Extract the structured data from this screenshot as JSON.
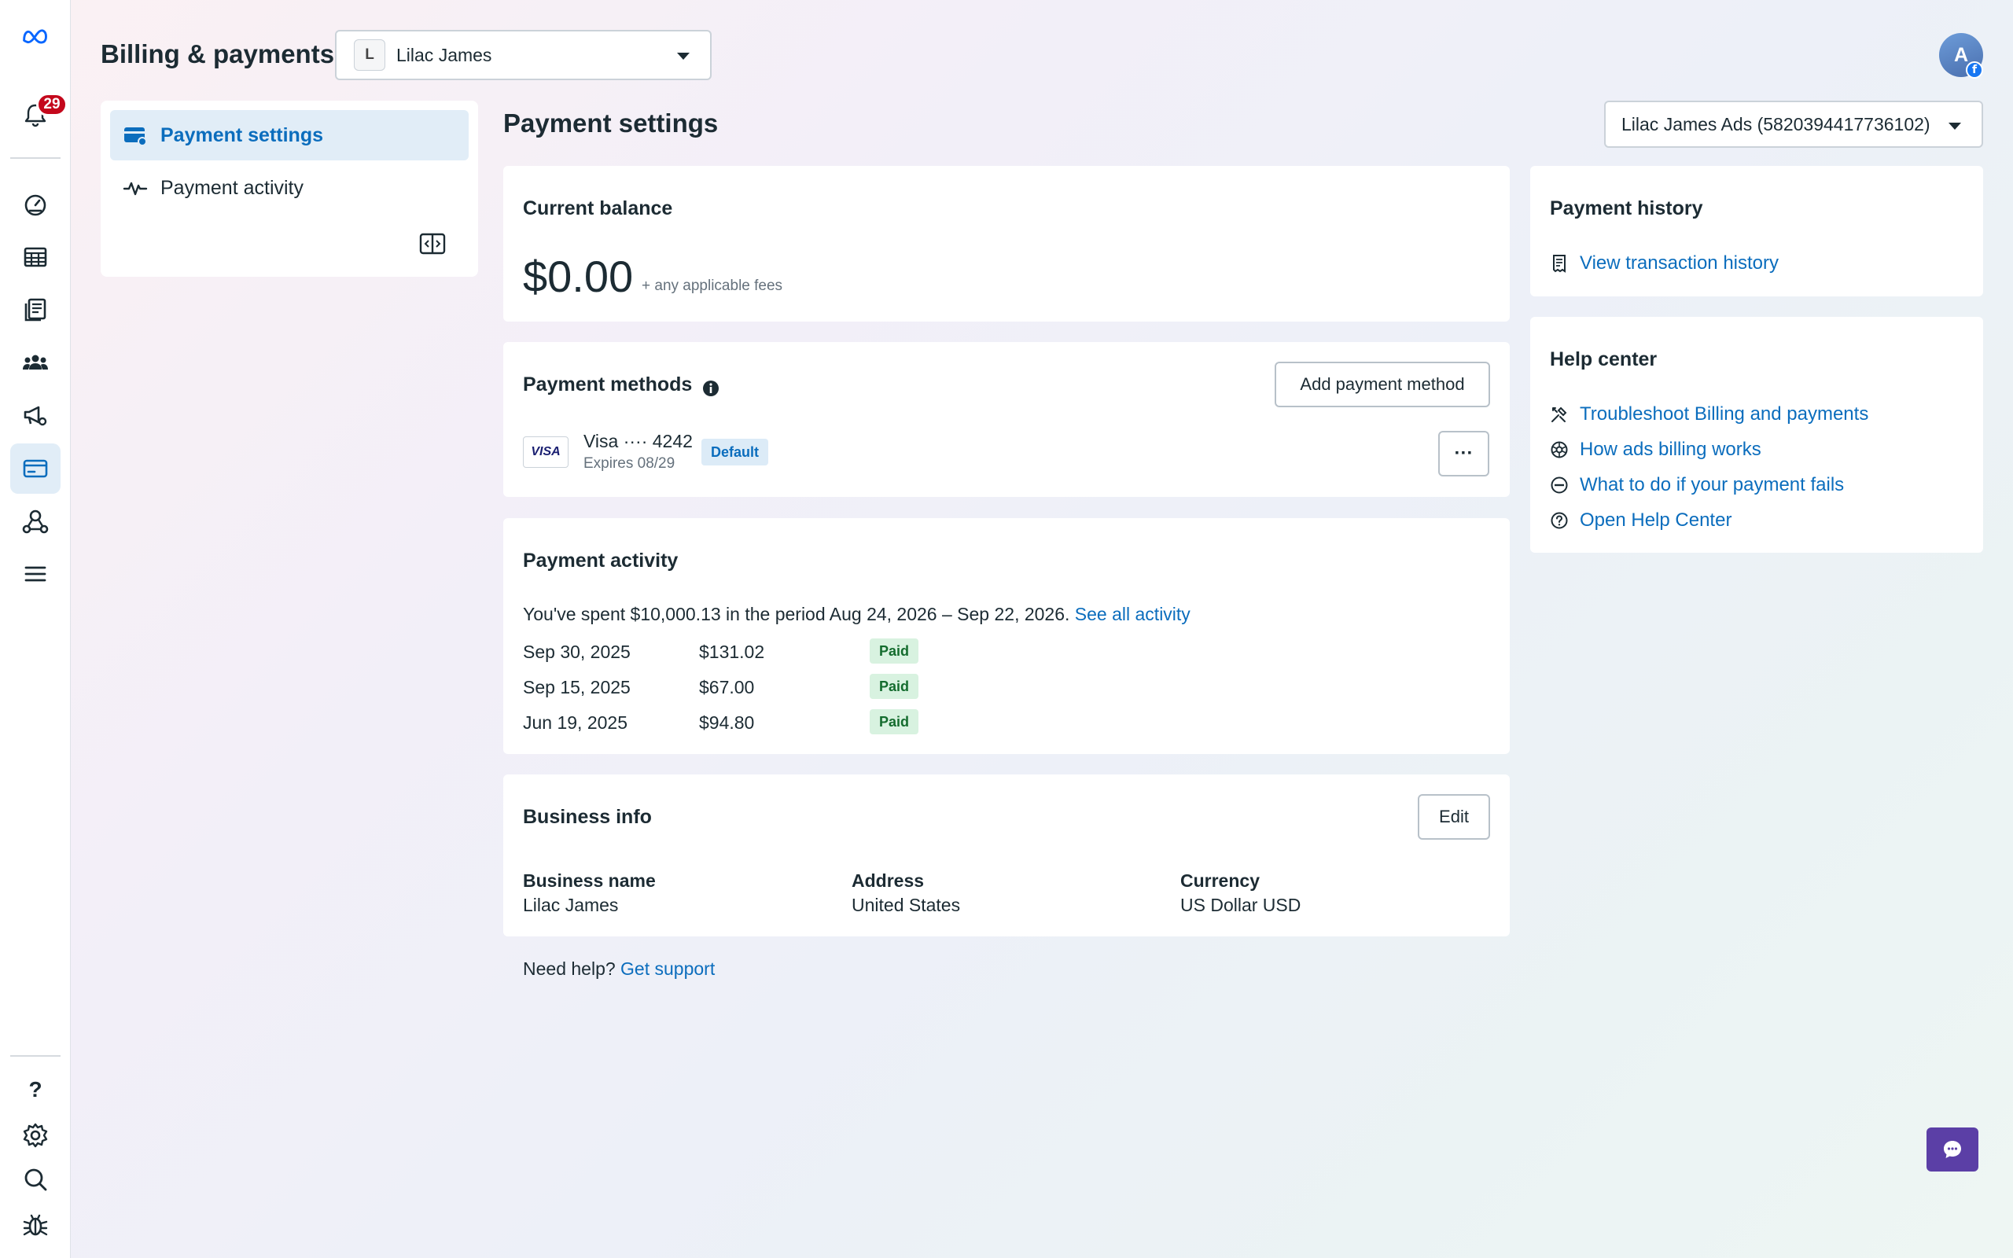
{
  "rail": {
    "notification_count": "29",
    "icons": [
      "meta-logo-icon",
      "bell-icon",
      "dashboard-icon",
      "table-icon",
      "pages-icon",
      "audience-icon",
      "ads-settings-icon",
      "billing-icon",
      "network-icon",
      "menu-icon",
      "help-icon",
      "settings-icon",
      "search-icon",
      "bug-icon"
    ],
    "help_label": "?"
  },
  "header": {
    "title": "Billing & payments",
    "account_letter": "L",
    "account_name": "Lilac James",
    "avatar_letter": "A",
    "avatar_badge": "f"
  },
  "sidenav": {
    "items": [
      {
        "label": "Payment settings",
        "active": true
      },
      {
        "label": "Payment activity",
        "active": false
      }
    ]
  },
  "main": {
    "section_title": "Payment settings",
    "ad_account": "Lilac James Ads (5820394417736102)",
    "balance": {
      "title": "Current balance",
      "amount": "$0.00",
      "fees_note": "+ any applicable fees"
    },
    "payment_methods": {
      "title": "Payment methods",
      "add_button": "Add payment method",
      "card": {
        "brand": "VISA",
        "name": "Visa ···· 4242",
        "expires": "Expires 08/29",
        "badge": "Default",
        "more_label": "···"
      }
    },
    "payment_activity": {
      "title": "Payment activity",
      "summary_text": "You've spent $10,000.13 in the period Aug 24, 2026 – Sep 22, 2026.",
      "see_all": "See all activity",
      "rows": [
        {
          "date": "Sep 30, 2025",
          "amount": "$131.02",
          "status": "Paid"
        },
        {
          "date": "Sep 15, 2025",
          "amount": "$67.00",
          "status": "Paid"
        },
        {
          "date": "Jun 19, 2025",
          "amount": "$94.80",
          "status": "Paid"
        }
      ]
    },
    "business_info": {
      "title": "Business info",
      "edit_button": "Edit",
      "fields": [
        {
          "label": "Business name",
          "value": "Lilac James"
        },
        {
          "label": "Address",
          "value": "United States"
        },
        {
          "label": "Currency",
          "value": "US Dollar USD"
        }
      ]
    },
    "help": {
      "prefix": "Need help?",
      "link": "Get support"
    }
  },
  "right": {
    "history": {
      "title": "Payment history",
      "link": "View transaction history"
    },
    "help_center": {
      "title": "Help center",
      "links": [
        "Troubleshoot Billing and payments",
        "How ads billing works",
        "What to do if your payment fails",
        "Open Help Center"
      ]
    }
  },
  "colors": {
    "accent": "#0b6dbd",
    "badge_red": "#c4081c",
    "paid_green": "#146c2e",
    "chat_purple": "#5b3fa6"
  }
}
